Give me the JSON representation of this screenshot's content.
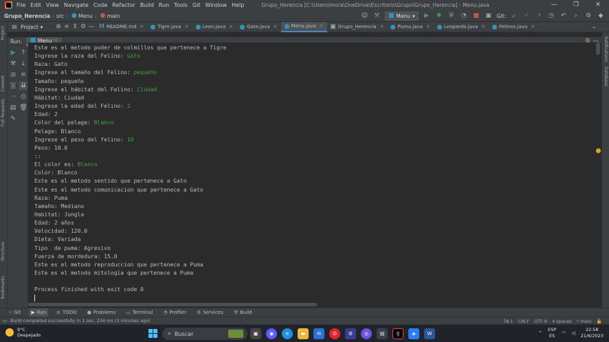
{
  "titlebar": {
    "menu": [
      "File",
      "Edit",
      "View",
      "Navigate",
      "Code",
      "Refactor",
      "Build",
      "Run",
      "Tools",
      "Git",
      "Window",
      "Help"
    ],
    "window_title": "Grupo_Herencia [C:\\Users\\mora\\OneDrive\\Escritorio\\Grupo\\Grupo_Herencia] - Menu.java",
    "controls": [
      "—",
      "❐",
      "✕"
    ]
  },
  "navbar": {
    "crumbs": [
      "Grupo_Herencia",
      "src",
      "Menu",
      "main"
    ],
    "run_config": "Menu",
    "git_label": "Git:"
  },
  "tabbar": {
    "project_label": "Project",
    "tabs": [
      "README.md",
      "Tigre.java",
      "Leon.java",
      "Gato.java",
      "Menu.java",
      "Grupo_Herencia",
      "Puma.java",
      "Leopardo.java",
      "Felinos.java"
    ],
    "active_index": 4
  },
  "left_strip": [
    "Project",
    "Commit",
    "Pull Requests",
    "Structure",
    "Bookmarks"
  ],
  "right_strip": [
    "Notifications",
    "Database"
  ],
  "run_panel": {
    "label": "Run:",
    "tab": "Menu"
  },
  "console": {
    "lines": [
      {
        "text": "Este es el metodo poder de colmillos que pertenece a Tigre",
        "input": ""
      },
      {
        "text": "Ingrese la raza del Felino: ",
        "input": "Gato"
      },
      {
        "text": "Raza: Gato",
        "input": ""
      },
      {
        "text": "Ingrese el tamaño del Felino: ",
        "input": "pequeño"
      },
      {
        "text": "Tamaño: pequeño",
        "input": ""
      },
      {
        "text": "Ingrese el hábitat del Felino: ",
        "input": "Ciudad"
      },
      {
        "text": "Hábitat: Ciudad",
        "input": ""
      },
      {
        "text": "Ingrese la edad del Felino: ",
        "input": "2"
      },
      {
        "text": "Edad: 2",
        "input": ""
      },
      {
        "text": "Color del pelage: ",
        "input": "Blanco"
      },
      {
        "text": "Pelage: Blanco",
        "input": ""
      },
      {
        "text": "Ingrese el peso del felino: ",
        "input": "10"
      },
      {
        "text": "Peso: 10.0",
        "input": ""
      },
      {
        "text": "::",
        "input": ""
      },
      {
        "text": "El color es: ",
        "input": "Blanco"
      },
      {
        "text": "Color: Blanco",
        "input": ""
      },
      {
        "text": "Este es el metodo sentido que pertenece a Gato",
        "input": ""
      },
      {
        "text": "Este es el metodo comunicacion que pertenece a Gato",
        "input": ""
      },
      {
        "text": "Raza: Puma",
        "input": ""
      },
      {
        "text": "Tamaño: Mediano",
        "input": ""
      },
      {
        "text": "Habitat: Jungla",
        "input": ""
      },
      {
        "text": "Edad: 2 años",
        "input": ""
      },
      {
        "text": "Velocidad: 120.0",
        "input": ""
      },
      {
        "text": "Dieta: Variada",
        "input": ""
      },
      {
        "text": "Tipo  de puma: Agresivo",
        "input": ""
      },
      {
        "text": "Fuerza de mordedura: 15.0",
        "input": ""
      },
      {
        "text": "Este es el metodo reproduccion que pertenece a Puma",
        "input": ""
      },
      {
        "text": "Este es el metodo mitología que pertenece a Puma",
        "input": ""
      },
      {
        "text": "",
        "input": ""
      },
      {
        "text": "Process finished with exit code 0",
        "input": ""
      }
    ]
  },
  "bottombar": [
    "Git",
    "Run",
    "TODO",
    "Problems",
    "Terminal",
    "Profiler",
    "Services",
    "Build"
  ],
  "statusbar": {
    "message": "Build completed successfully in 1 sec, 234 ms (3 minutes ago)",
    "position": "78:1",
    "line_sep": "CRLF",
    "encoding": "UTF-8",
    "indent": "4 spaces",
    "branch": "main"
  },
  "taskbar": {
    "temp": "9°C",
    "weather": "Despejado",
    "search_placeholder": "Buscar",
    "lang1": "ESP",
    "lang2": "ES",
    "time": "22:58",
    "date": "21/6/2023"
  },
  "colors": {
    "accent": "#4a88c7",
    "console_input": "#44a340",
    "run_green": "#499c54"
  }
}
